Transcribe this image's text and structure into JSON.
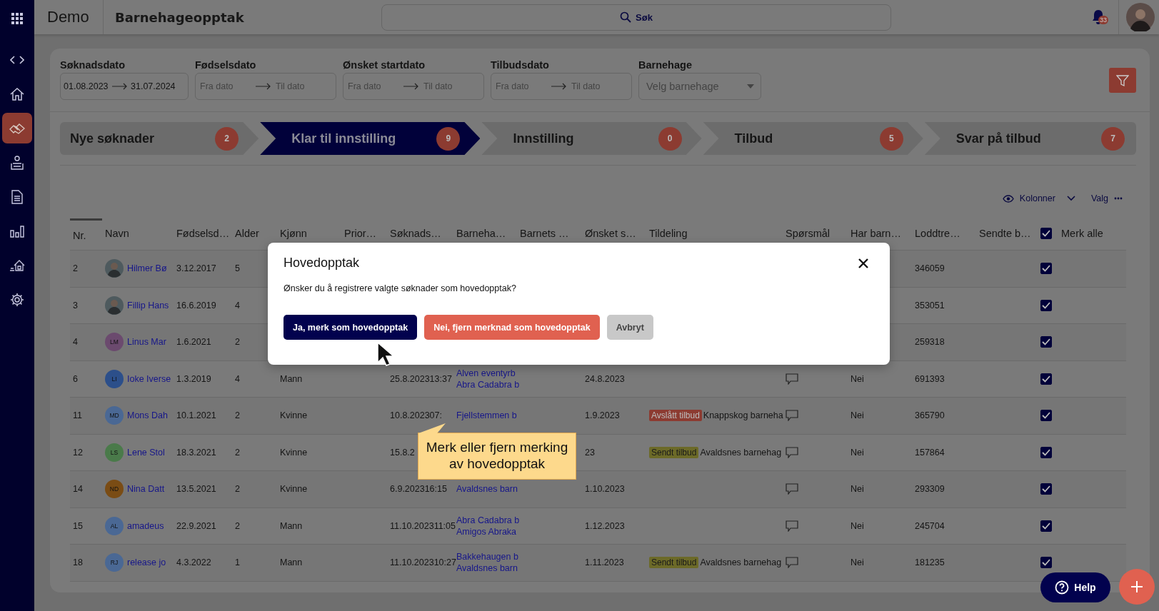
{
  "header": {
    "app_name": "Demo",
    "title": "Barnehageopptak",
    "search_label": "Søk",
    "notification_count": "33"
  },
  "sidebar": {
    "items": [
      {
        "kind": "apps",
        "selected": false
      },
      {
        "kind": "code",
        "selected": false
      },
      {
        "kind": "home",
        "selected": false
      },
      {
        "kind": "handshake",
        "selected": true
      },
      {
        "kind": "people",
        "selected": false
      },
      {
        "kind": "document",
        "selected": false
      },
      {
        "kind": "chart",
        "selected": false
      },
      {
        "kind": "house",
        "selected": false
      },
      {
        "kind": "gear",
        "selected": false
      }
    ]
  },
  "filters": [
    {
      "label": "Søknadsdato",
      "from": "01.08.2023",
      "to": "31.07.2024"
    },
    {
      "label": "Fødselsdato",
      "from_placeholder": "Fra dato",
      "to_placeholder": "Til dato"
    },
    {
      "label": "Ønsket startdato",
      "from_placeholder": "Fra dato",
      "to_placeholder": "Til dato"
    },
    {
      "label": "Tilbudsdato",
      "from_placeholder": "Fra dato",
      "to_placeholder": "Til dato"
    }
  ],
  "kindergarten_filter": {
    "label": "Barnehage",
    "placeholder": "Velg barnehage"
  },
  "steps": [
    {
      "label": "Nye søknader",
      "count": "2",
      "selected": false
    },
    {
      "label": "Klar til innstilling",
      "count": "9",
      "selected": true
    },
    {
      "label": "Innstilling",
      "count": "0",
      "selected": false
    },
    {
      "label": "Tilbud",
      "count": "5",
      "selected": false
    },
    {
      "label": "Svar på tilbud",
      "count": "7",
      "selected": false
    }
  ],
  "table_tools": {
    "columns": "Kolonner",
    "options": "Valg"
  },
  "table": {
    "columns": [
      "Nr.",
      "Navn",
      "Fødselsd…",
      "Alder",
      "Kjønn",
      "Prior…",
      "Søknads…",
      "Barneha…",
      "Barnets …",
      "Ønsket s…",
      "Tildeling",
      "Spørsmål",
      "Har barn…",
      "Loddtre…",
      "Sendte b…",
      "Merk alle"
    ],
    "select_all_checked": true,
    "rows": [
      {
        "nr": "2",
        "avatar": {
          "kind": "photo"
        },
        "name": "Hilmer Bø",
        "birth": "3.12.2017",
        "age": "5",
        "lottery": "346059",
        "checked": true
      },
      {
        "nr": "3",
        "avatar": {
          "kind": "photo"
        },
        "name": "Fillip Hans",
        "birth": "16.6.2019",
        "age": "4",
        "lottery": "353051",
        "checked": true
      },
      {
        "nr": "4",
        "avatar": {
          "kind": "initials",
          "initials": "LM",
          "color": "#6b4a6e"
        },
        "name": "Linus Mar",
        "birth": "1.6.2021",
        "age": "2",
        "lottery": "259318",
        "checked": true
      },
      {
        "nr": "6",
        "avatar": {
          "kind": "initials",
          "initials": "LI",
          "color": "#2c4f8a"
        },
        "name": "Ioke Iverse",
        "birth": "1.3.2019",
        "age": "4",
        "gender": "Mann",
        "applied": "25.8.202313:37",
        "kindergartens": [
          "Alven eventyrb",
          "Abra Cadabra b"
        ],
        "start": "24.8.2023",
        "question": true,
        "siblings": "Nei",
        "lottery": "691393",
        "checked": true
      },
      {
        "nr": "11",
        "avatar": {
          "kind": "initials",
          "initials": "MD",
          "color": "#4a6894"
        },
        "name": "Mons Dah",
        "birth": "10.1.2021",
        "age": "2",
        "gender": "Kvinne",
        "applied": "10.8.202307:",
        "kindergartens": [
          "Fjellstemmen b"
        ],
        "start": "1.9.2023",
        "status": {
          "label": "Avslått tilbud",
          "kind": "declined"
        },
        "allocated": "Knappskog barneha",
        "question": true,
        "siblings": "Nei",
        "lottery": "365790",
        "checked": true
      },
      {
        "nr": "12",
        "avatar": {
          "kind": "initials",
          "initials": "LS",
          "color": "#4a7a4a"
        },
        "name": "Lene Stol",
        "birth": "18.3.2021",
        "age": "2",
        "gender": "Kvinne",
        "applied": "15.8.2",
        "start": "23",
        "status": {
          "label": "Sendt tilbud",
          "kind": "sent"
        },
        "allocated": "Avaldsnes barnehag",
        "question": true,
        "siblings": "Nei",
        "lottery": "157864",
        "checked": true
      },
      {
        "nr": "14",
        "avatar": {
          "kind": "initials",
          "initials": "ND",
          "color": "#7a4c14"
        },
        "name": "Nina Datt",
        "birth": "13.5.2021",
        "age": "2",
        "gender": "Kvinne",
        "applied": "6.9.202316:15",
        "kindergartens": [
          "Avaldsnes barn"
        ],
        "start": "1.10.2023",
        "question": true,
        "siblings": "Nei",
        "lottery": "293309",
        "checked": true
      },
      {
        "nr": "15",
        "avatar": {
          "kind": "initials",
          "initials": "AL",
          "color": "#4a6894"
        },
        "name": "amadeus",
        "birth": "22.9.2021",
        "age": "2",
        "gender": "Mann",
        "applied": "11.10.202311:05",
        "kindergartens": [
          "Abra Cadabra b",
          "Amigos Abraka"
        ],
        "start": "1.12.2023",
        "question": true,
        "siblings": "Nei",
        "lottery": "245704",
        "checked": true
      },
      {
        "nr": "18",
        "avatar": {
          "kind": "initials",
          "initials": "RJ",
          "color": "#4a6894"
        },
        "name": "release jo",
        "birth": "4.3.2022",
        "age": "1",
        "gender": "Mann",
        "applied": "11.10.202310:27",
        "kindergartens": [
          "Bakkehaugen b",
          "Avaldsnes barn"
        ],
        "start": "1.11.2023",
        "status": {
          "label": "Sendt tilbud",
          "kind": "sent"
        },
        "allocated": "Avaldsnes barnehag",
        "question": true,
        "siblings": "Nei",
        "lottery": "181235",
        "checked": true
      }
    ]
  },
  "dialog": {
    "title": "Hovedopptak",
    "text": "Ønsker du å registrere valgte søknader som hovedopptak?",
    "buttons": [
      {
        "label": "Ja, merk som hovedopptak",
        "kind": "primary"
      },
      {
        "label": "Nei, fjern merknad som hovedopptak",
        "kind": "danger"
      },
      {
        "label": "Avbryt",
        "kind": "secondary"
      }
    ]
  },
  "callout": {
    "text": "Merk eller fjern merking\nav hovedopptak"
  },
  "help_button": {
    "label": "Help"
  }
}
